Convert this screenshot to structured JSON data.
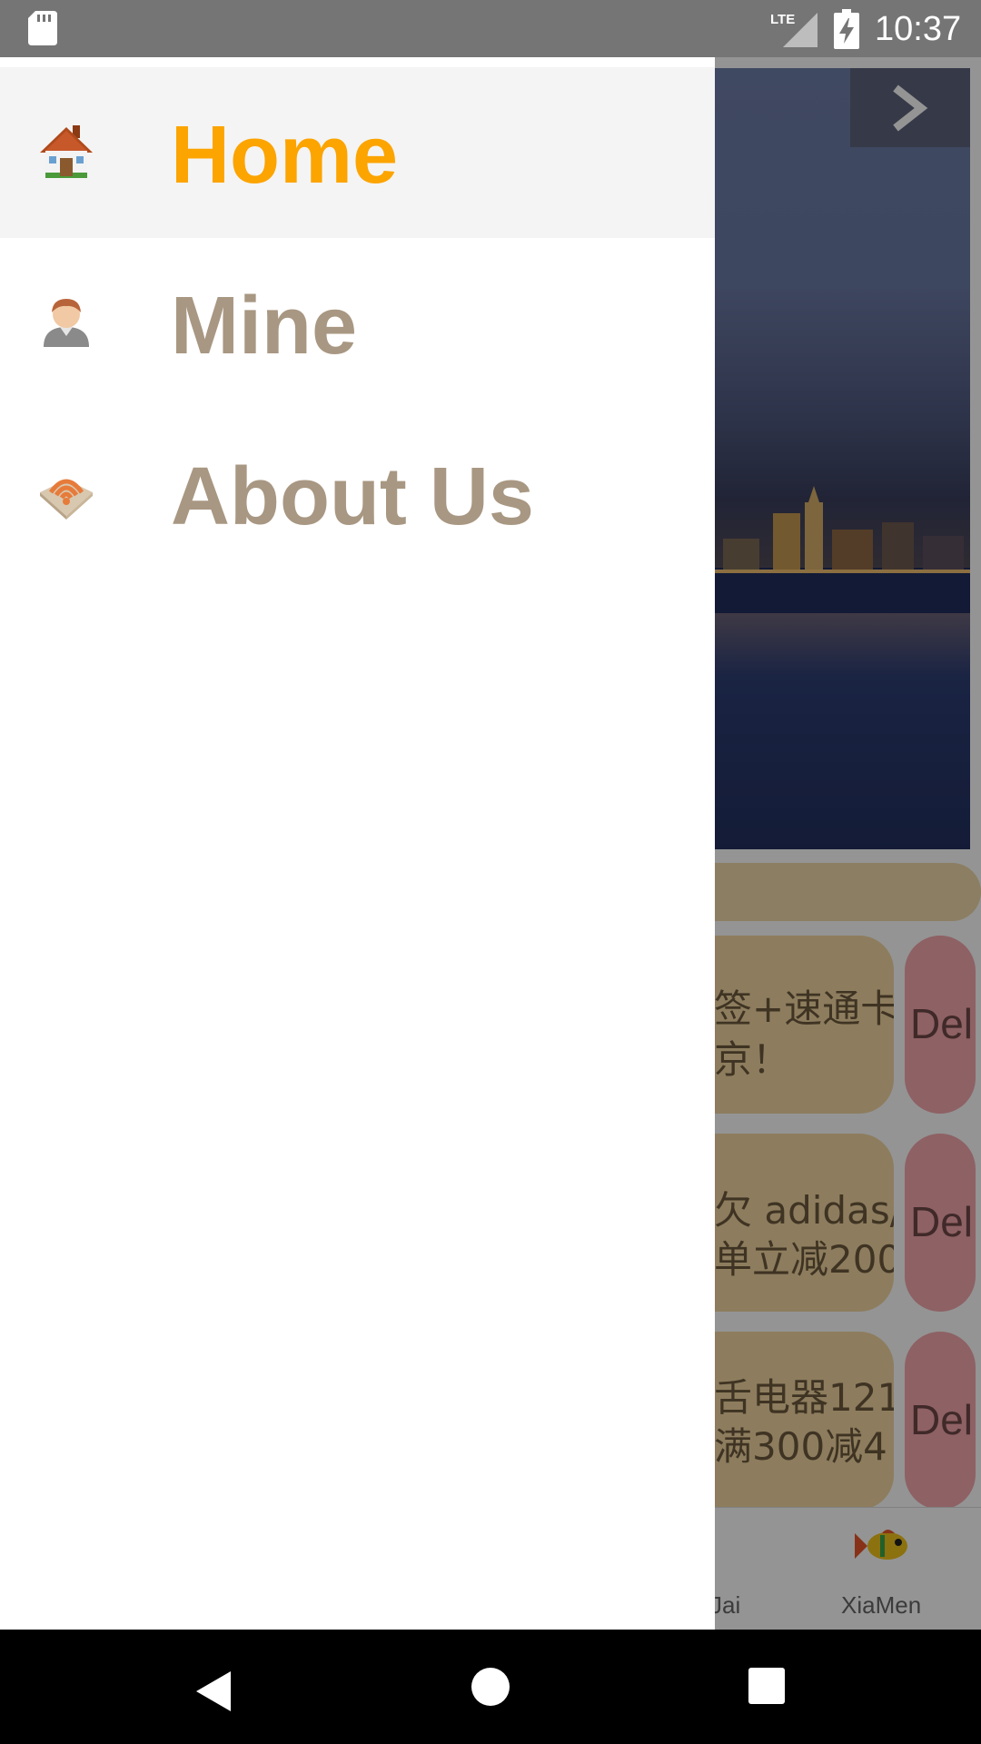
{
  "status_bar": {
    "time": "10:37",
    "network": "LTE",
    "icons": [
      "sd-card-icon",
      "lte-signal-icon",
      "battery-charging-icon"
    ]
  },
  "drawer": {
    "items": [
      {
        "label": "Home",
        "icon": "house-icon",
        "active": true
      },
      {
        "label": "Mine",
        "icon": "user-icon",
        "active": false
      },
      {
        "label": "About Us",
        "icon": "wifi-map-icon",
        "active": false
      }
    ],
    "colors": {
      "active": "#fca400",
      "inactive": "#a89782",
      "active_bg": "#f4f4f4"
    }
  },
  "background_app": {
    "ads": [
      {
        "line1": "签+速通卡",
        "line2": "京！",
        "delete_label": "Del"
      },
      {
        "line1": "欠 adidas/T",
        "line2": "单立减200",
        "delete_label": "Del"
      },
      {
        "line1": "舌电器121",
        "line2": "满300减4",
        "delete_label": "Del"
      }
    ],
    "bottom_tabs": [
      {
        "label": "Jai"
      },
      {
        "label": "XiaMen",
        "icon": "fish-icon"
      }
    ]
  },
  "nav_bar": {
    "buttons": [
      "back-icon",
      "home-circle-icon",
      "recents-square-icon"
    ]
  }
}
